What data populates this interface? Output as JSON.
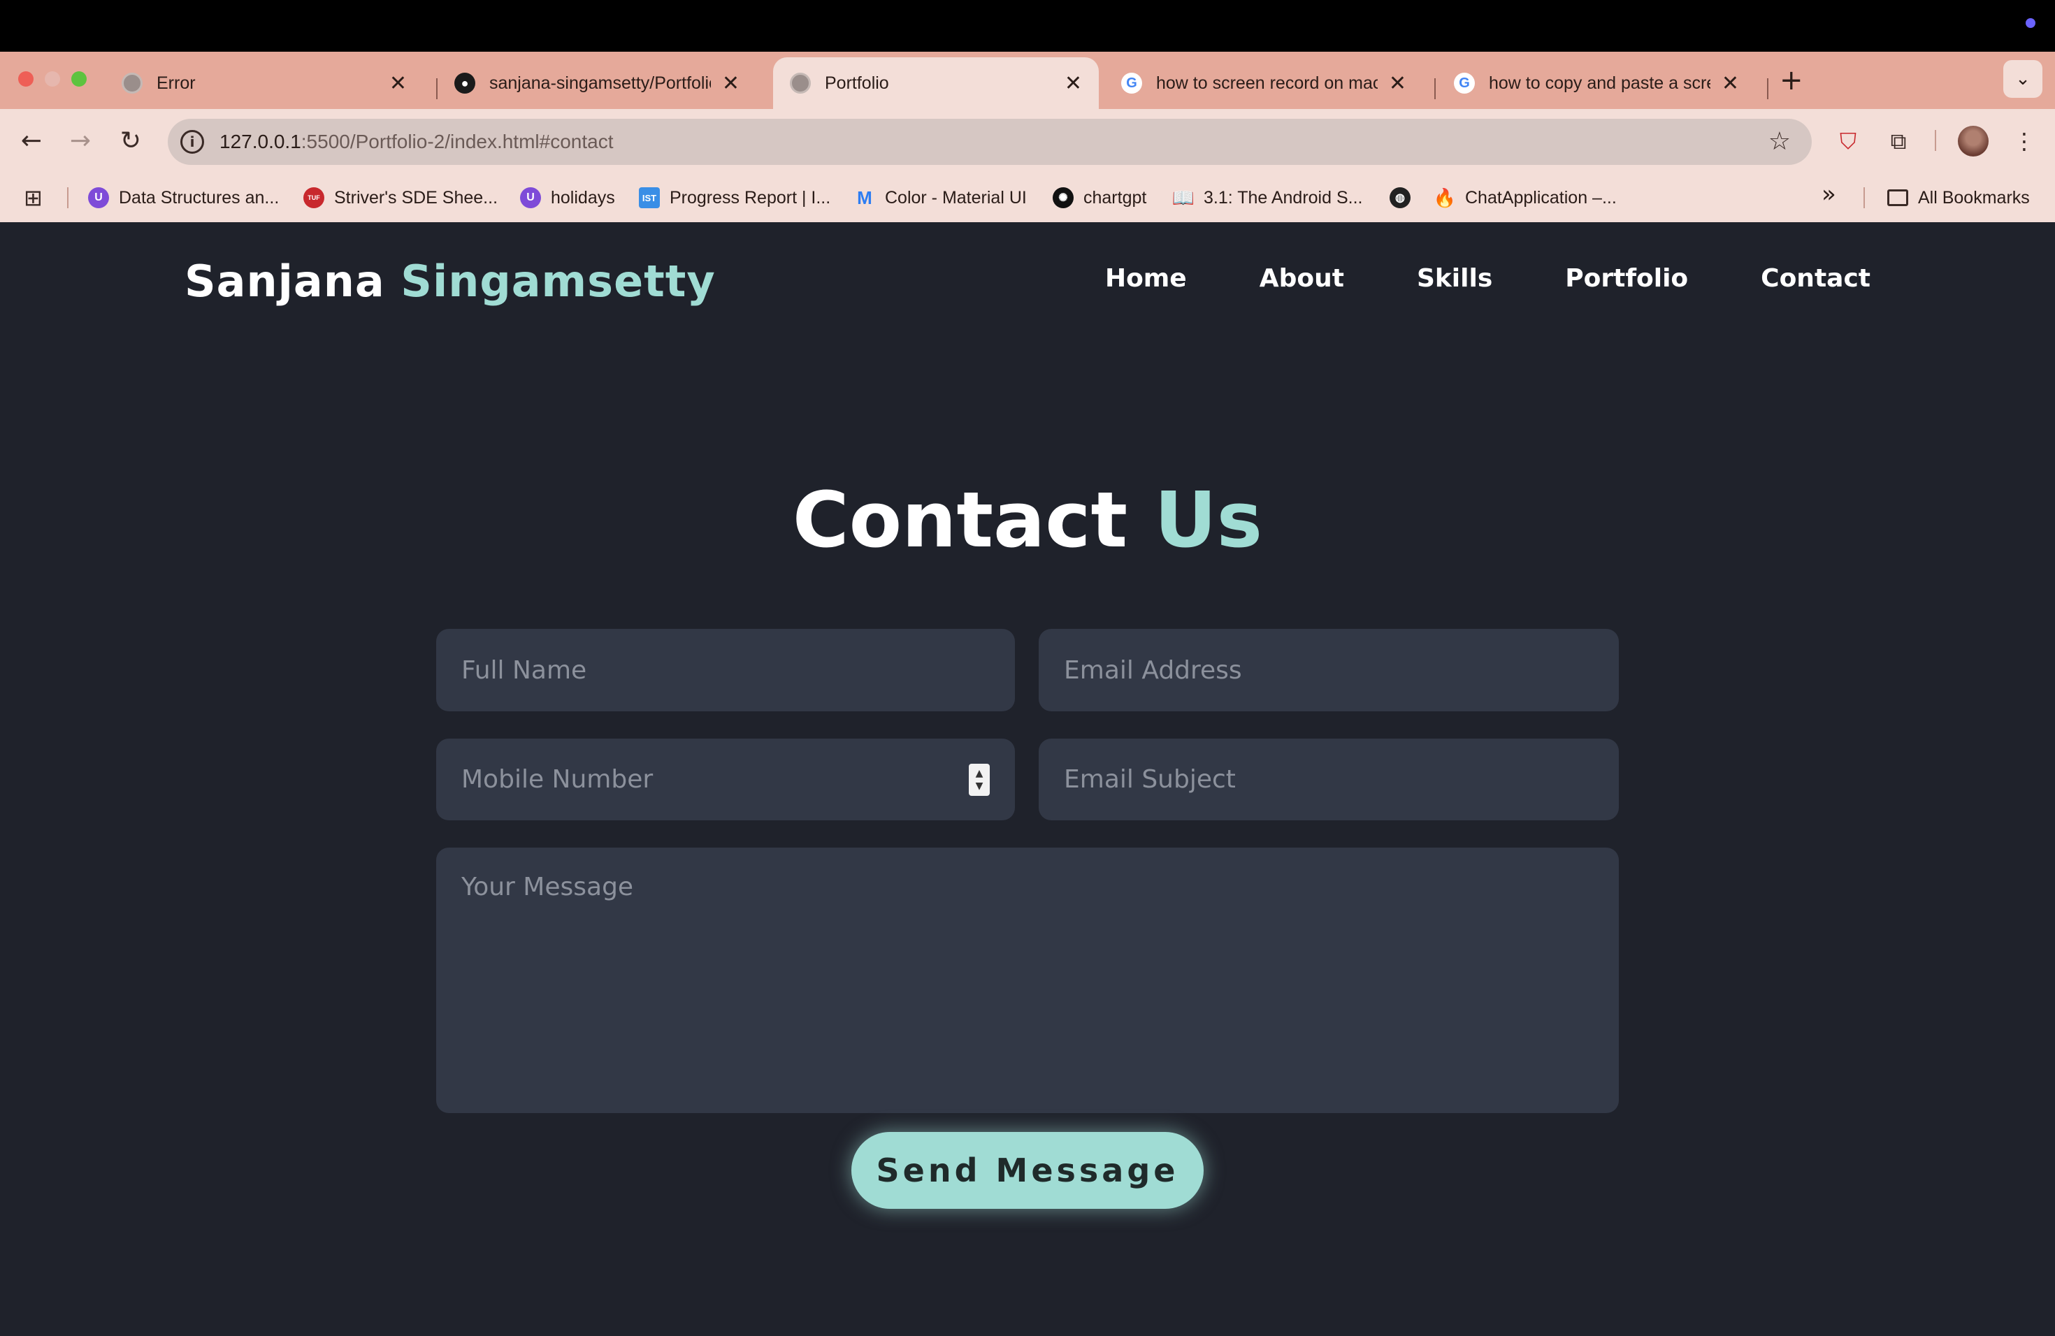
{
  "browser": {
    "tabs": [
      {
        "title": "Error",
        "favicon": "globe-icon"
      },
      {
        "title": "sanjana-singamsetty/Portfolio",
        "favicon": "github-icon"
      },
      {
        "title": "Portfolio",
        "favicon": "globe-icon",
        "active": true
      },
      {
        "title": "how to screen record on mac",
        "favicon": "google-icon"
      },
      {
        "title": "how to copy and paste a scre",
        "favicon": "google-icon"
      }
    ],
    "url_host": "127.0.0.1",
    "url_path": ":5500/Portfolio-2/index.html#contact",
    "bookmarks": [
      {
        "label": "Data Structures an...",
        "icon": "U"
      },
      {
        "label": "Striver's SDE Shee...",
        "icon": "TUF"
      },
      {
        "label": "holidays",
        "icon": "U"
      },
      {
        "label": "Progress Report | I...",
        "icon": "IST"
      },
      {
        "label": "Color - Material UI",
        "icon": "M"
      },
      {
        "label": "chartgpt",
        "icon": "✺"
      },
      {
        "label": "3.1: The Android S...",
        "icon": "📖"
      },
      {
        "label": "ChatApplication –...",
        "icon": "🔥"
      }
    ],
    "all_bookmarks": "All Bookmarks",
    "colors": {
      "tabbar": "#e5a99a",
      "toolbar": "#f3ded8"
    }
  },
  "site": {
    "logo_first": "Sanjana",
    "logo_second": "Singamsetty",
    "nav": [
      "Home",
      "About",
      "Skills",
      "Portfolio",
      "Contact"
    ],
    "heading_first": "Contact",
    "heading_second": "Us",
    "form": {
      "full_name": "Full Name",
      "email": "Email Address",
      "mobile": "Mobile Number",
      "subject": "Email Subject",
      "message": "Your Message",
      "submit": "Send Message"
    },
    "colors": {
      "accent": "#a0dcd4",
      "background": "#1f222b",
      "field": "#323846"
    }
  }
}
